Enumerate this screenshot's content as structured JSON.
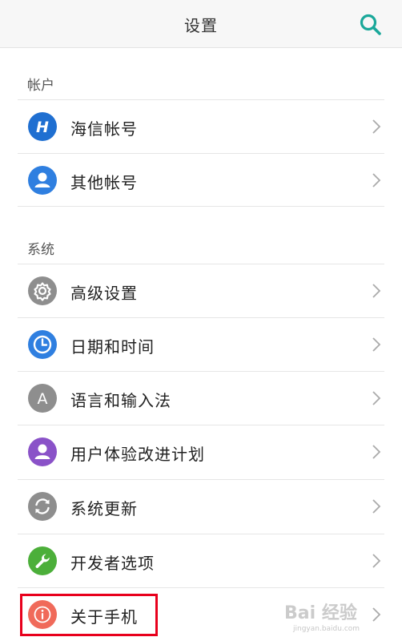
{
  "header": {
    "title": "设置",
    "search_icon": "search-icon",
    "accent_color": "#1aa89a"
  },
  "sections": [
    {
      "label": "帐户",
      "items": [
        {
          "label": "海信帐号",
          "icon": "hisense-logo-icon",
          "color": "#1f6fd1"
        },
        {
          "label": "其他帐号",
          "icon": "person-icon",
          "color": "#2f7fe0"
        }
      ]
    },
    {
      "label": "系统",
      "items": [
        {
          "label": "高级设置",
          "icon": "gear-icon",
          "color": "#8e8e8e"
        },
        {
          "label": "日期和时间",
          "icon": "clock-icon",
          "color": "#2f7fe0"
        },
        {
          "label": "语言和输入法",
          "icon": "letter-a-icon",
          "color": "#8e8e8e"
        },
        {
          "label": "用户体验改进计划",
          "icon": "person-icon",
          "color": "#8a52c8"
        },
        {
          "label": "系统更新",
          "icon": "refresh-icon",
          "color": "#8e8e8e"
        },
        {
          "label": "开发者选项",
          "icon": "wrench-icon",
          "color": "#4caf3a"
        },
        {
          "label": "关于手机",
          "icon": "info-icon",
          "color": "#f06a5a"
        }
      ]
    }
  ],
  "watermark": {
    "text": "Bai 经验",
    "sub": "jingyan.baidu.com"
  }
}
